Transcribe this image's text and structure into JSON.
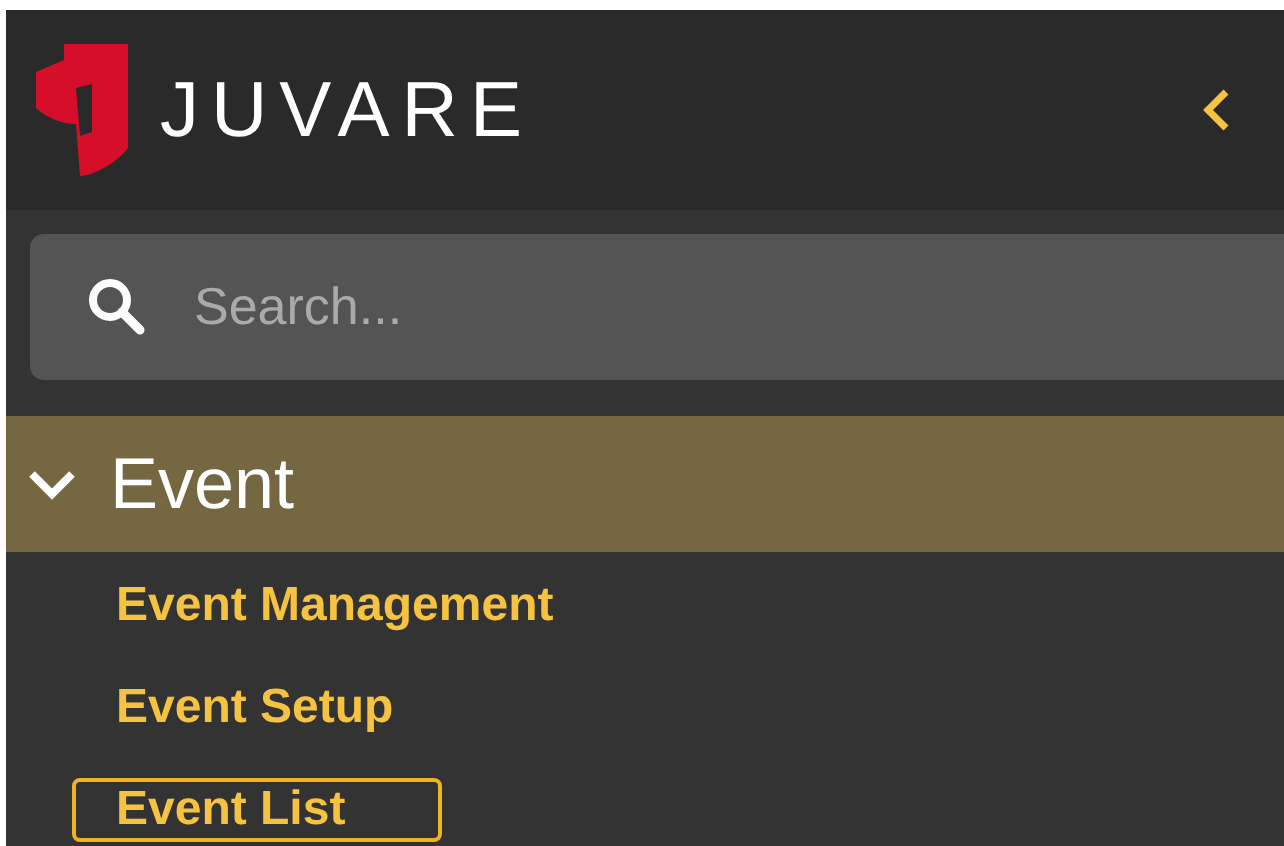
{
  "header": {
    "brand": "JUVARE"
  },
  "search": {
    "placeholder": "Search..."
  },
  "menu_group": {
    "label": "Event",
    "expanded": true,
    "items": [
      {
        "label": "Event Management",
        "selected": false
      },
      {
        "label": "Event Setup",
        "selected": false
      },
      {
        "label": "Event List",
        "selected": true
      }
    ]
  }
}
